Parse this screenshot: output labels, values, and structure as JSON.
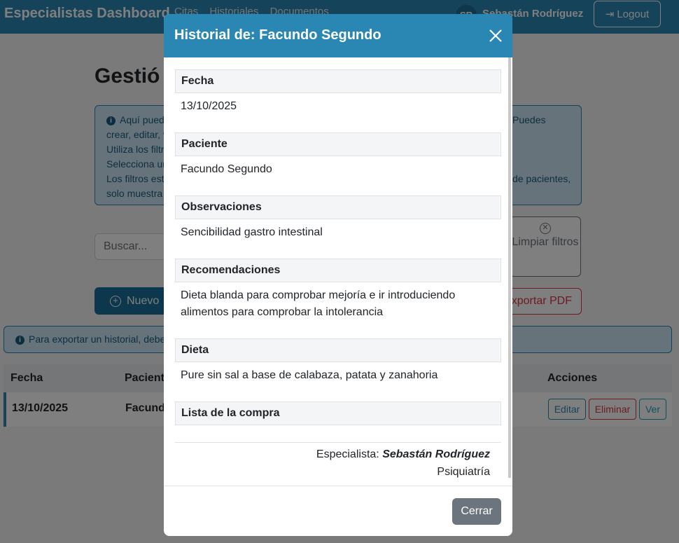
{
  "navbar": {
    "brand": "Especialistas Dashboard",
    "links": [
      "Citas",
      "Historiales",
      "Documentos"
    ],
    "avatar_initials": "SR",
    "username": "Sebastán Rodríguez",
    "logout_label": "Logout"
  },
  "page": {
    "title": "Gestió",
    "info_lines_left": [
      "Aquí pued",
      "crear, editar, v",
      "Utiliza los filtr",
      "Selecciona ur",
      "Los filtros est",
      "solo muestra"
    ],
    "info_lines_right": [
      "Puedes",
      "",
      "",
      "",
      "de pacientes,",
      ""
    ],
    "search_placeholder": "Buscar...",
    "clear_filters_label": "Limpiar filtros",
    "new_button_label": "Nuevo",
    "export_pdf_label": "xportar PDF",
    "export_alert": "Para exportar un historial, debe"
  },
  "table": {
    "headers": {
      "fecha": "Fecha",
      "paciente": "Paciente",
      "acciones": "Acciones"
    },
    "rows": [
      {
        "fecha": "13/10/2025",
        "paciente": "Facundo",
        "actions": {
          "edit": "Editar",
          "delete": "Eliminar",
          "view": "Ver"
        }
      }
    ]
  },
  "modal": {
    "title": "Historial de: Facundo Segundo",
    "sections": [
      {
        "label": "Fecha",
        "value": "13/10/2025"
      },
      {
        "label": "Paciente",
        "value": "Facundo Segundo"
      },
      {
        "label": "Observaciones",
        "value": "Sencibilidad gastro intestinal"
      },
      {
        "label": "Recomendaciones",
        "value": "Dieta blanda para comprobar mejoría e ir introduciendo alimentos para comprobar la intolerancia"
      },
      {
        "label": "Dieta",
        "value": "Pure sin sal a base de calabaza, patata y zanahoria"
      },
      {
        "label": "Lista de la compra",
        "value": ""
      }
    ],
    "specialist_prefix": "Especialista:",
    "specialist_name": "Sebastán Rodríguez",
    "specialty": "Psiquiatría",
    "close_label": "Cerrar"
  },
  "colors": {
    "primary": "#2a86b3",
    "danger": "#dc3545",
    "secondary": "#6c757d"
  }
}
